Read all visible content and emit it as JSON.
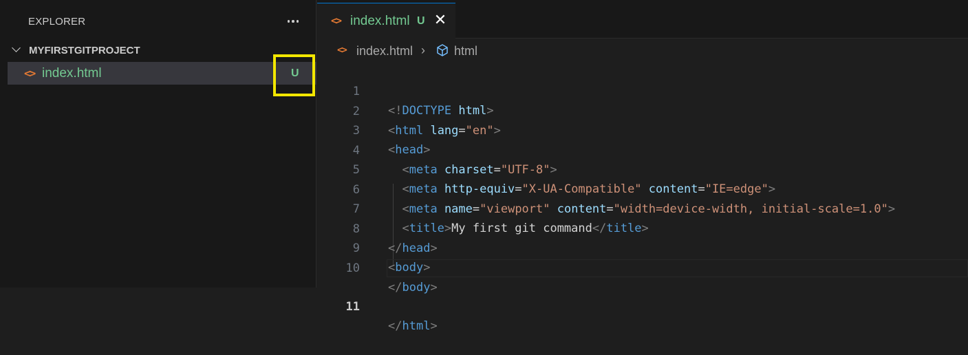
{
  "sidebar": {
    "title": "EXPLORER",
    "more_label": "...",
    "project": "MYFIRSTGITPROJECT",
    "files": [
      {
        "name": "index.html",
        "status": "U",
        "icon": "html-file-icon"
      }
    ]
  },
  "tab": {
    "name": "index.html",
    "status": "U",
    "close_glyph": "✕"
  },
  "breadcrumbs": {
    "file": "index.html",
    "separator": "›",
    "symbol": "html",
    "symbol_icon": "cube-icon"
  },
  "colors": {
    "untracked": "#73c991",
    "html_icon": "#e37933",
    "highlight_box": "#f2e600",
    "tag": "#569cd6",
    "attribute": "#9cdcfe",
    "string": "#ce9178"
  },
  "editor": {
    "active_line": "11",
    "lines": [
      {
        "n": "1",
        "parts": {
          "p1": "<!",
          "tag": "DOCTYPE",
          "sp": " ",
          "attr": "html",
          "p2": ">"
        }
      },
      {
        "n": "2",
        "parts": {
          "p1": "<",
          "tag": "html",
          "attr": "lang",
          "eq": "=",
          "val": "\"en\"",
          "p2": ">"
        }
      },
      {
        "n": "3",
        "parts": {
          "p1": "<",
          "tag": "head",
          "p2": ">"
        }
      },
      {
        "n": "4",
        "parts": {
          "p1": "<",
          "tag": "meta",
          "attr": "charset",
          "eq": "=",
          "val": "\"UTF-8\"",
          "p2": ">"
        }
      },
      {
        "n": "5",
        "parts": {
          "p1": "<",
          "tag": "meta",
          "attr": "http-equiv",
          "eq": "=",
          "val": "\"X-UA-Compatible\"",
          "attr2": "content",
          "eq2": "=",
          "val2": "\"IE=edge\"",
          "p2": ">"
        }
      },
      {
        "n": "6",
        "parts": {
          "p1": "<",
          "tag": "meta",
          "attr": "name",
          "eq": "=",
          "val": "\"viewport\"",
          "attr2": "content",
          "eq2": "=",
          "val2": "\"width=device-width, initial-scale=1.0\"",
          "p2": ">"
        }
      },
      {
        "n": "7",
        "parts": {
          "p1": "<",
          "tag": "title",
          "p2": ">",
          "text": "My first git command",
          "p3": "</",
          "tag2": "title",
          "p4": ">"
        }
      },
      {
        "n": "8",
        "parts": {
          "p1": "</",
          "tag": "head",
          "p2": ">"
        }
      },
      {
        "n": "9",
        "parts": {
          "p1": "<",
          "tag": "body",
          "p2": ">"
        }
      },
      {
        "n": "10",
        "parts": {
          "p1": "</",
          "tag": "body",
          "p2": ">"
        }
      },
      {
        "n": "11",
        "parts": {
          "p1": "</",
          "tag": "html",
          "p2": ">"
        }
      }
    ]
  }
}
